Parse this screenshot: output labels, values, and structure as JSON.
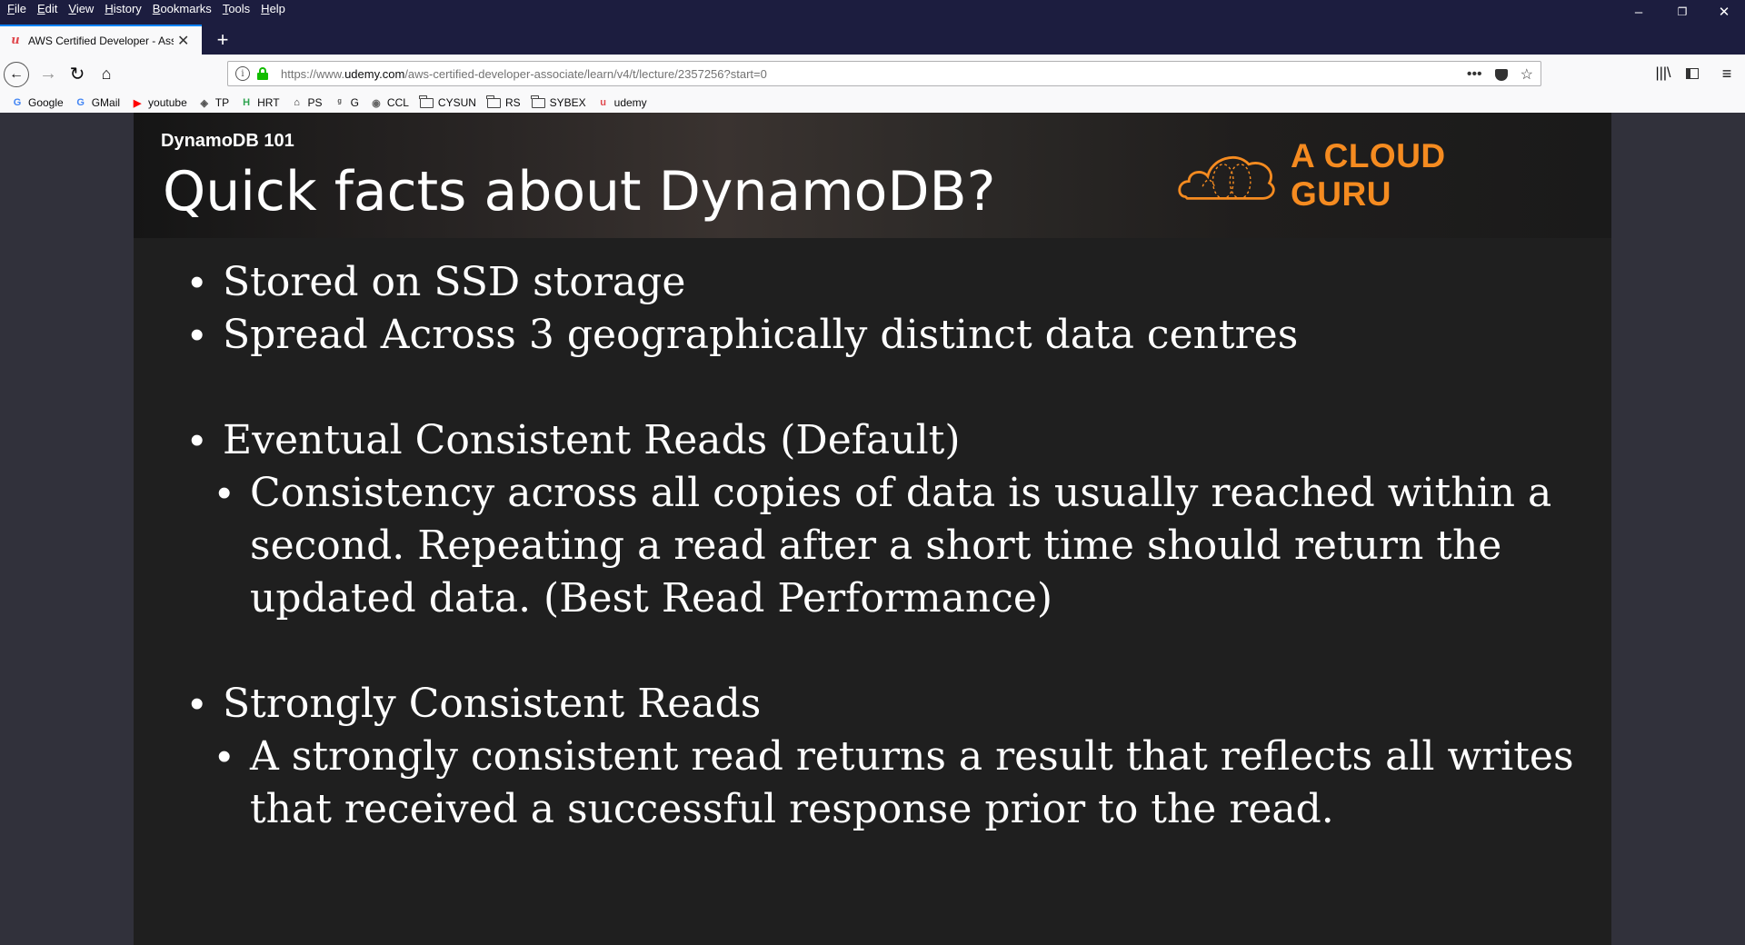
{
  "menu": [
    "File",
    "Edit",
    "View",
    "History",
    "Bookmarks",
    "Tools",
    "Help"
  ],
  "window_controls": {
    "minimize": "–",
    "restore": "❐",
    "close": "✕"
  },
  "tab": {
    "title": "AWS Certified Developer - Asso",
    "favicon": "udemy-icon"
  },
  "newtab_label": "+",
  "url": {
    "prefix": "https://www.",
    "host": "udemy.com",
    "path": "/aws-certified-developer-associate/learn/v4/t/lecture/2357256?start=0"
  },
  "bookmarks": [
    {
      "label": "Google",
      "icon": "google-icon",
      "color": "#4285f4",
      "glyph": "G"
    },
    {
      "label": "GMail",
      "icon": "google-icon",
      "color": "#4285f4",
      "glyph": "G"
    },
    {
      "label": "youtube",
      "icon": "youtube-icon",
      "color": "#ff0000",
      "glyph": "▶"
    },
    {
      "label": "TP",
      "icon": "diamond-icon",
      "color": "#555555",
      "glyph": "◈"
    },
    {
      "label": "HRT",
      "icon": "hrt-icon",
      "color": "#2ea44f",
      "glyph": "H"
    },
    {
      "label": "PS",
      "icon": "ps-icon",
      "color": "#222222",
      "glyph": "⌂"
    },
    {
      "label": "G",
      "icon": "g-icon",
      "color": "#555555",
      "glyph": "ᵍ"
    },
    {
      "label": "CCL",
      "icon": "shield-icon",
      "color": "#666666",
      "glyph": "◉"
    },
    {
      "label": "CYSUN",
      "icon": "folder-icon",
      "folder": true
    },
    {
      "label": "RS",
      "icon": "folder-icon",
      "folder": true
    },
    {
      "label": "SYBEX",
      "icon": "folder-icon",
      "folder": true
    },
    {
      "label": "udemy",
      "icon": "udemy-icon",
      "color": "#e0474c",
      "glyph": "u"
    }
  ],
  "slide": {
    "subtitle": "DynamoDB 101",
    "title": "Quick facts about DynamoDB?",
    "logo_text": "A CLOUD GURU",
    "accent": "#f58b20",
    "bullets": {
      "b1": "Stored on SSD storage",
      "b2": "Spread Across 3 geographically distinct data centres",
      "b3": "Eventual Consistent Reads (Default)",
      "b3_sub": "Consistency across all copies of data is usually reached within a second. Repeating a read after a short time should return the updated data. (Best Read Performance)",
      "b4": "Strongly Consistent Reads",
      "b4_sub": "A strongly consistent read returns a result that reflects all writes that received a successful response prior to the read."
    }
  }
}
